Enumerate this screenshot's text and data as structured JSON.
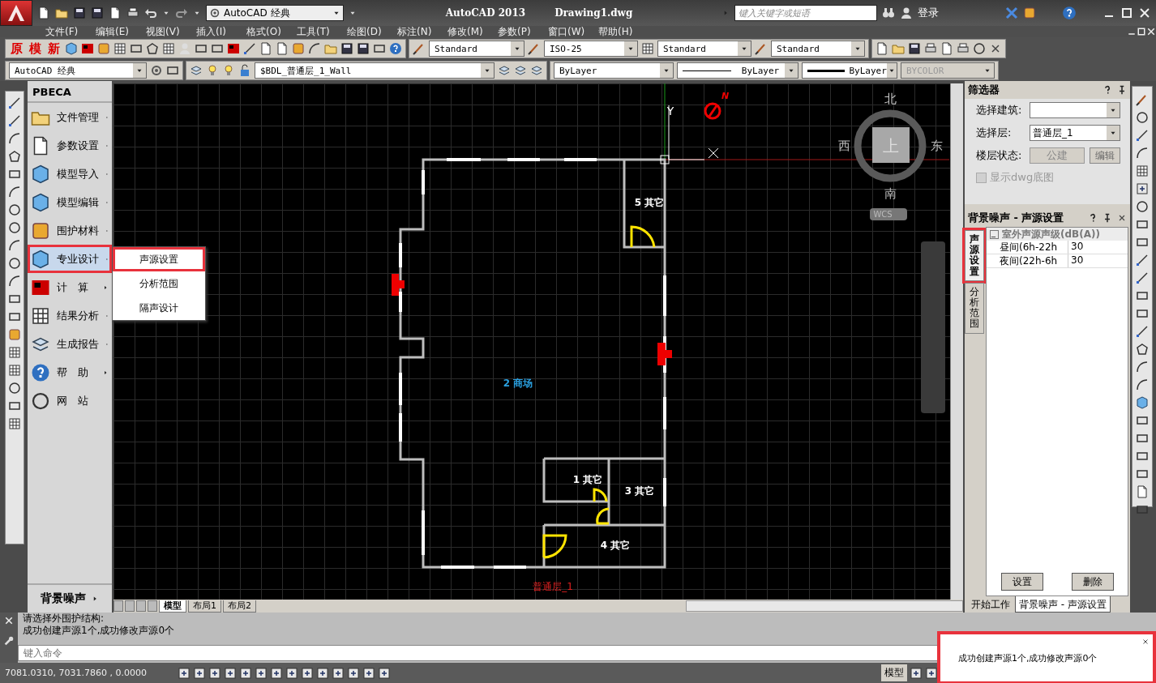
{
  "title_bar": {
    "workspace": "AutoCAD 经典",
    "app_title": "AutoCAD 2013",
    "file_name": "Drawing1.dwg",
    "search": {
      "placeholder": "键入关键字或短语"
    },
    "login": "登录"
  },
  "menu_bar": [
    "文件(F)",
    "编辑(E)",
    "视图(V)",
    "插入(I)",
    "格式(O)",
    "工具(T)",
    "绘图(D)",
    "标注(N)",
    "修改(M)",
    "参数(P)",
    "窗口(W)",
    "帮助(H)"
  ],
  "toolbar": {
    "custom_buttons": [
      "原",
      "模",
      "新"
    ],
    "text_style": "Standard",
    "dim_style": "ISO-25",
    "table_style": "Standard",
    "multileader_style": "Standard"
  },
  "properties_bar": {
    "workspace": "AutoCAD 经典",
    "layer": "$BDL_普通层_1_Wall",
    "color_setting": "ByLayer",
    "linetype": "ByLayer",
    "lineweight": "ByLayer",
    "plot_style": {
      "value": "BYCOLOR",
      "disabled": true
    }
  },
  "side_menu": {
    "title": "PBECA",
    "items": [
      {
        "label": "文件管理",
        "has_submenu": true,
        "selected": false,
        "highlighted": false
      },
      {
        "label": "参数设置",
        "has_submenu": true,
        "selected": false,
        "highlighted": false
      },
      {
        "label": "模型导入",
        "has_submenu": true,
        "selected": false,
        "highlighted": false
      },
      {
        "label": "模型编辑",
        "has_submenu": true,
        "selected": false,
        "highlighted": false
      },
      {
        "label": "围护材料",
        "has_submenu": true,
        "selected": false,
        "highlighted": false
      },
      {
        "label": "专业设计",
        "has_submenu": true,
        "selected": true,
        "highlighted": true
      },
      {
        "label": "计　算",
        "has_submenu": true,
        "selected": false,
        "highlighted": false
      },
      {
        "label": "结果分析",
        "has_submenu": true,
        "selected": false,
        "highlighted": false
      },
      {
        "label": "生成报告",
        "has_submenu": true,
        "selected": false,
        "highlighted": false
      },
      {
        "label": "帮　助",
        "has_submenu": true,
        "selected": false,
        "highlighted": false
      },
      {
        "label": "网　站",
        "has_submenu": false,
        "selected": false,
        "highlighted": false
      }
    ],
    "footer": "背景噪声"
  },
  "submenu": {
    "items": [
      {
        "label": "声源设置",
        "highlighted": true
      },
      {
        "label": "分析范围",
        "highlighted": false
      },
      {
        "label": "隔声设计",
        "highlighted": false
      }
    ]
  },
  "drawing": {
    "axis_y": "Y",
    "north_label": "N",
    "rooms": [
      {
        "label": "5 其它",
        "color": "#ffffff"
      },
      {
        "label": "2 商场",
        "color": "#2aa0e0"
      },
      {
        "label": "1 其它",
        "color": "#ffffff"
      },
      {
        "label": "3 其它",
        "color": "#ffffff"
      },
      {
        "label": "4 其它",
        "color": "#ffffff"
      }
    ],
    "floor_label": "普通层_1",
    "view_cube": {
      "north": "北",
      "west": "西",
      "east": "东",
      "south": "南",
      "face": "上",
      "ucs": "WCS"
    }
  },
  "layout_tabs": [
    {
      "label": "模型",
      "selected": true
    },
    {
      "label": "布局1",
      "selected": false
    },
    {
      "label": "布局2",
      "selected": false
    }
  ],
  "filter_panel": {
    "title": "筛选器",
    "building": {
      "label": "选择建筑:"
    },
    "floor": {
      "label": "选择层:",
      "value": "普通层_1"
    },
    "floor_status": {
      "label": "楼层状态:",
      "value": "公建",
      "disabled": true
    },
    "edit_button": "编辑",
    "show_dwg": {
      "label": "显示dwg底图",
      "checked": false,
      "disabled": true
    }
  },
  "source_panel": {
    "title": "背景噪声 - 声源设置",
    "side_tabs": [
      {
        "label": "声源设置",
        "selected": true,
        "highlighted": true
      },
      {
        "label": "分析范围",
        "selected": false,
        "highlighted": false
      }
    ],
    "category": {
      "label": "室外声源声级(dB(A))",
      "expanded": true
    },
    "rows": [
      {
        "name": "昼间(6h-22h",
        "value": "30"
      },
      {
        "name": "夜间(22h-6h",
        "value": "30"
      }
    ],
    "buttons": [
      "设置",
      "删除"
    ]
  },
  "palette_tabs": [
    {
      "label": "开始工作",
      "selected": false
    },
    {
      "label": "背景噪声 - 声源设置",
      "selected": true
    }
  ],
  "command": {
    "history": [
      "请选择外围护结构:",
      "成功创建声源1个,成功修改声源0个"
    ],
    "placeholder": "键入命令"
  },
  "status_bar": {
    "coordinates": "7081.0310, 7031.7860 , 0.0000",
    "space": "模型"
  },
  "notification": {
    "text": "成功创建声源1个,成功修改声源0个",
    "highlighted": true
  }
}
